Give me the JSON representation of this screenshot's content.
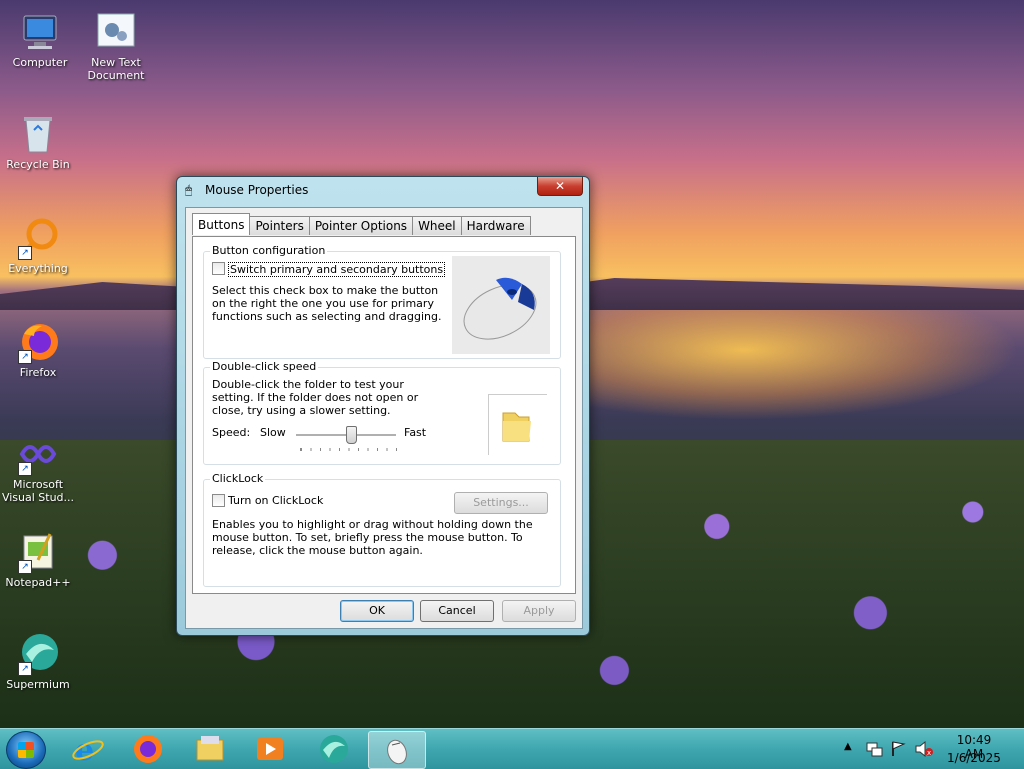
{
  "desktop": {
    "icons": [
      {
        "label": "Computer",
        "icon": "computer-icon"
      },
      {
        "label": "New Text Document",
        "icon": "text-document-icon"
      },
      {
        "label": "Recycle Bin",
        "icon": "recycle-bin-icon"
      },
      {
        "label": "Everything",
        "icon": "everything-icon"
      },
      {
        "label": "Firefox",
        "icon": "firefox-icon"
      },
      {
        "label": "Microsoft Visual Stud...",
        "icon": "visual-studio-icon"
      },
      {
        "label": "Notepad++",
        "icon": "notepadpp-icon"
      },
      {
        "label": "Supermium",
        "icon": "supermium-icon"
      }
    ]
  },
  "dialog": {
    "title": "Mouse Properties",
    "close_label": "✕",
    "tabs": [
      "Buttons",
      "Pointers",
      "Pointer Options",
      "Wheel",
      "Hardware"
    ],
    "active_tab": "Buttons",
    "button_config": {
      "legend": "Button configuration",
      "checkbox_label": "Switch primary and secondary buttons",
      "checked": false,
      "description": "Select this check box to make the button on the right the one you use for primary functions such as selecting and dragging."
    },
    "double_click": {
      "legend": "Double-click speed",
      "description": "Double-click the folder to test your setting. If the folder does not open or close, try using a slower setting.",
      "speed_label": "Speed:",
      "slow_label": "Slow",
      "fast_label": "Fast",
      "slider_value": 0.55
    },
    "clicklock": {
      "legend": "ClickLock",
      "checkbox_label": "Turn on ClickLock",
      "checked": false,
      "settings_label": "Settings...",
      "description": "Enables you to highlight or drag without holding down the mouse button. To set, briefly press the mouse button. To release, click the mouse button again."
    },
    "buttons": {
      "ok": "OK",
      "cancel": "Cancel",
      "apply": "Apply"
    }
  },
  "taskbar": {
    "items": [
      "internet-explorer-icon",
      "firefox-icon",
      "file-explorer-icon",
      "media-player-icon",
      "supermium-icon",
      "mouse-properties-icon"
    ],
    "clock_time": "10:49 AM",
    "clock_date": "1/6/2025"
  }
}
